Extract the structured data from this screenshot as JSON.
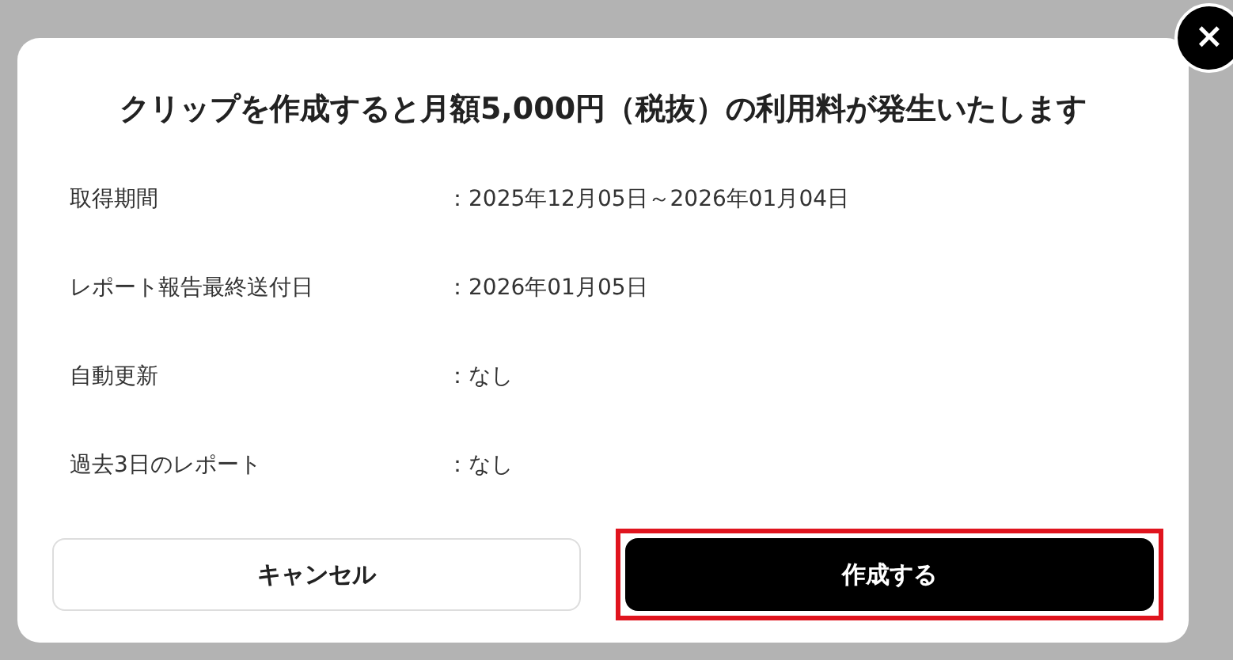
{
  "dialog": {
    "title": "クリップを作成すると月額5,000円（税抜）の利用料が発生いたします",
    "close_button": "×",
    "details": [
      {
        "label": "取得期間",
        "value": "：2025年12月05日～2026年01月04日"
      },
      {
        "label": "レポート報告最終送付日",
        "value": "：2026年01月05日"
      },
      {
        "label": "自動更新",
        "value": "：なし"
      },
      {
        "label": "過去3日のレポート",
        "value": "：なし"
      }
    ],
    "buttons": [
      {
        "label": "キャンセル",
        "kind": "secondary",
        "highlighted": false
      },
      {
        "label": "作成する",
        "kind": "primary",
        "highlighted": true
      }
    ]
  }
}
